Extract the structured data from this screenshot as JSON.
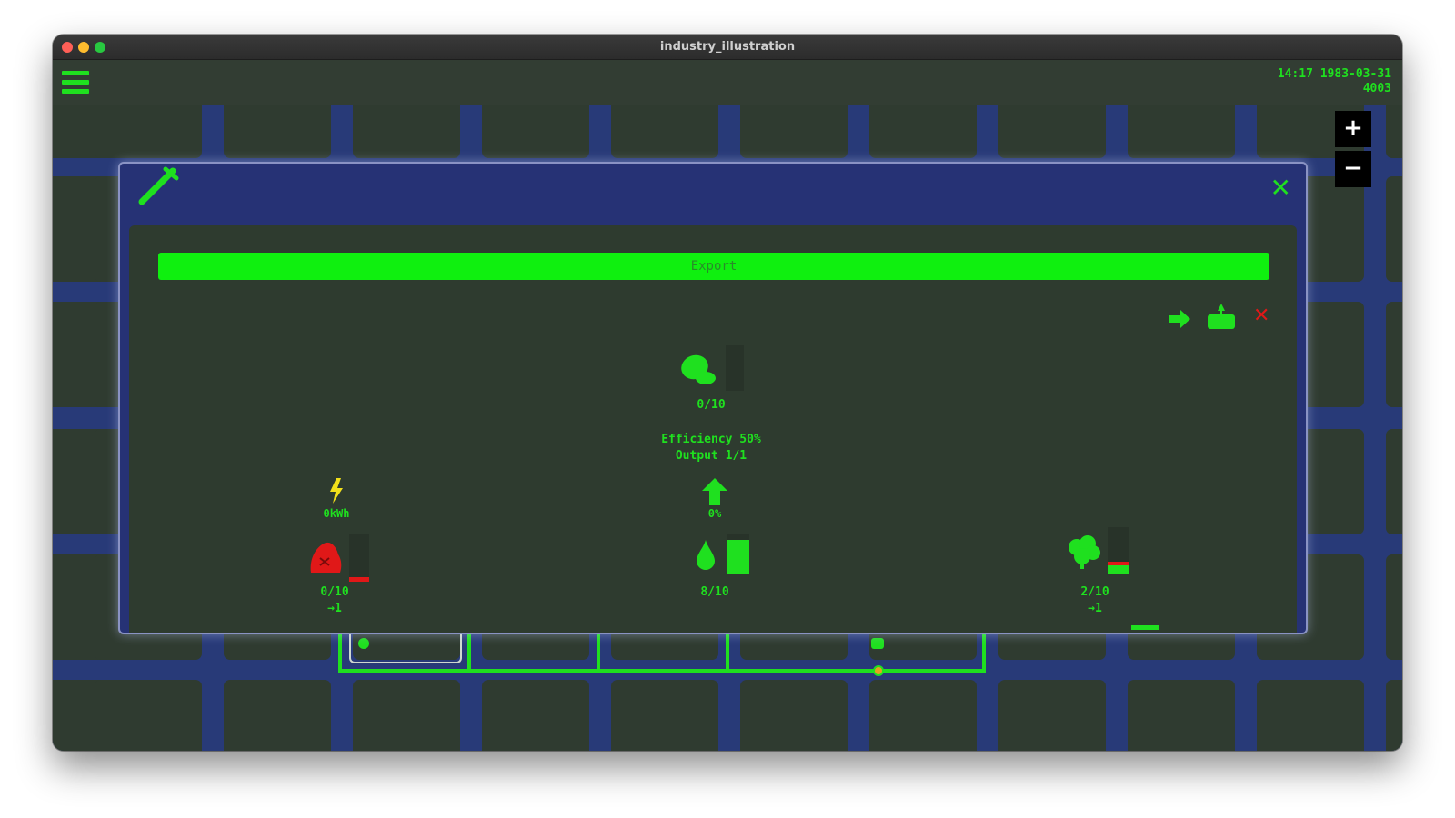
{
  "window": {
    "title": "industry_illustration"
  },
  "topbar": {
    "menu_icon": "hamburger-menu-icon",
    "time": "14:17 1983-03-31",
    "money": "4003"
  },
  "zoom": {
    "in_label": "+",
    "out_label": "−"
  },
  "dialog": {
    "icon": "hammer-icon",
    "close_label": "✕",
    "export_label": "Export",
    "actions": [
      {
        "icon": "arrow-right-icon",
        "color": "#1fe01f"
      },
      {
        "icon": "lift-icon",
        "color": "#1fe01f"
      },
      {
        "icon": "delete-x-icon",
        "color": "#e01818",
        "label": "✕"
      }
    ],
    "product": {
      "icon": "product-crate-icon",
      "amount": "0/10"
    },
    "stats": {
      "efficiency": "Efficiency 50%",
      "output": "Output 1/1"
    },
    "power": {
      "icon": "lightning-icon",
      "value": "0kWh"
    },
    "upgrade": {
      "icon": "arrow-up-icon",
      "value": "0%"
    },
    "inputs": [
      {
        "icon": "ore-pile-icon",
        "amount": "0/10",
        "rate": "→1",
        "level": 0.1,
        "color": "#e01818"
      },
      {
        "icon": "water-drop-icon",
        "amount": "8/10",
        "rate": "",
        "level": 0.8,
        "color": "#1fe01f"
      },
      {
        "icon": "cotton-icon",
        "amount": "2/10",
        "rate": "→1",
        "level": 0.2,
        "color": "#1fe01f"
      }
    ]
  },
  "colors": {
    "accent": "#1fe01f",
    "danger": "#e01818",
    "warning": "#f2e01a",
    "map_road": "#283a78",
    "tile": "#2f3b30"
  }
}
